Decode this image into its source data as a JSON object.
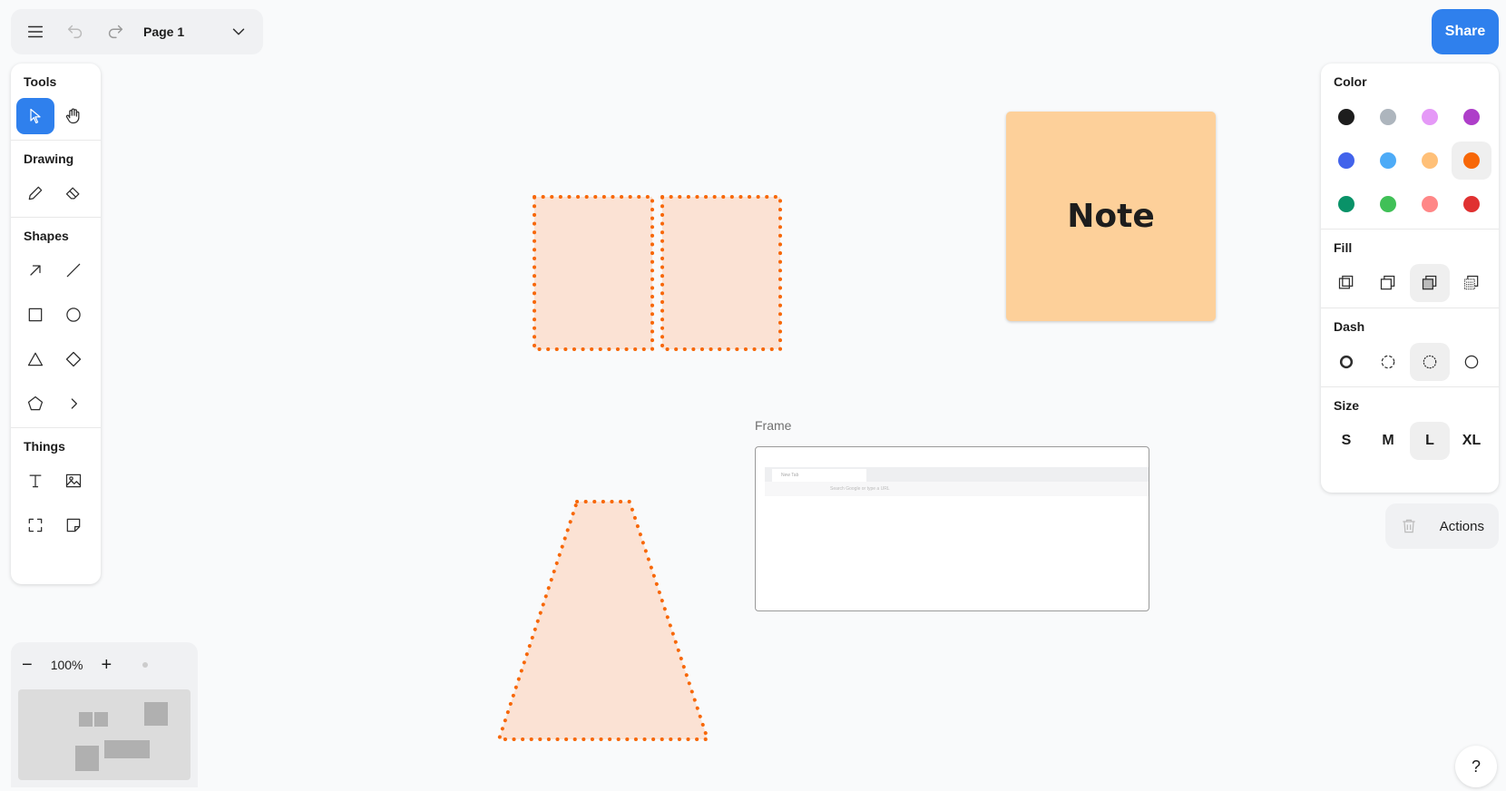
{
  "topbar": {
    "page_name": "Page 1",
    "icons": [
      "menu-icon",
      "undo-icon",
      "redo-icon",
      "chevron-down-icon"
    ]
  },
  "share_label": "Share",
  "toolbar": {
    "sections": [
      {
        "title": "Tools"
      },
      {
        "title": "Drawing"
      },
      {
        "title": "Shapes"
      },
      {
        "title": "Things"
      }
    ],
    "active_tool": "select"
  },
  "style_panel": {
    "color_title": "Color",
    "colors": [
      "#1d1d1d",
      "#adb5bd",
      "#e599f7",
      "#ae3ec9",
      "#4263eb",
      "#4dabf7",
      "#ffc078",
      "#f76707",
      "#099268",
      "#40c057",
      "#ff8787",
      "#e03131"
    ],
    "selected_color": "#f76707",
    "fill_title": "Fill",
    "selected_fill": "solid",
    "dash_title": "Dash",
    "selected_dash": "dotted",
    "size_title": "Size",
    "sizes": [
      "S",
      "M",
      "L",
      "XL"
    ],
    "selected_size": "L"
  },
  "actions_label": "Actions",
  "canvas": {
    "note_text": "Note",
    "frame_label": "Frame",
    "frame_tab": "New Tab",
    "frame_url_placeholder": "Search Google or type a URL",
    "shape_stroke": "#f76707",
    "shape_fill": "#fbe2d4"
  },
  "zoom": {
    "level": "100%"
  },
  "help_label": "?"
}
